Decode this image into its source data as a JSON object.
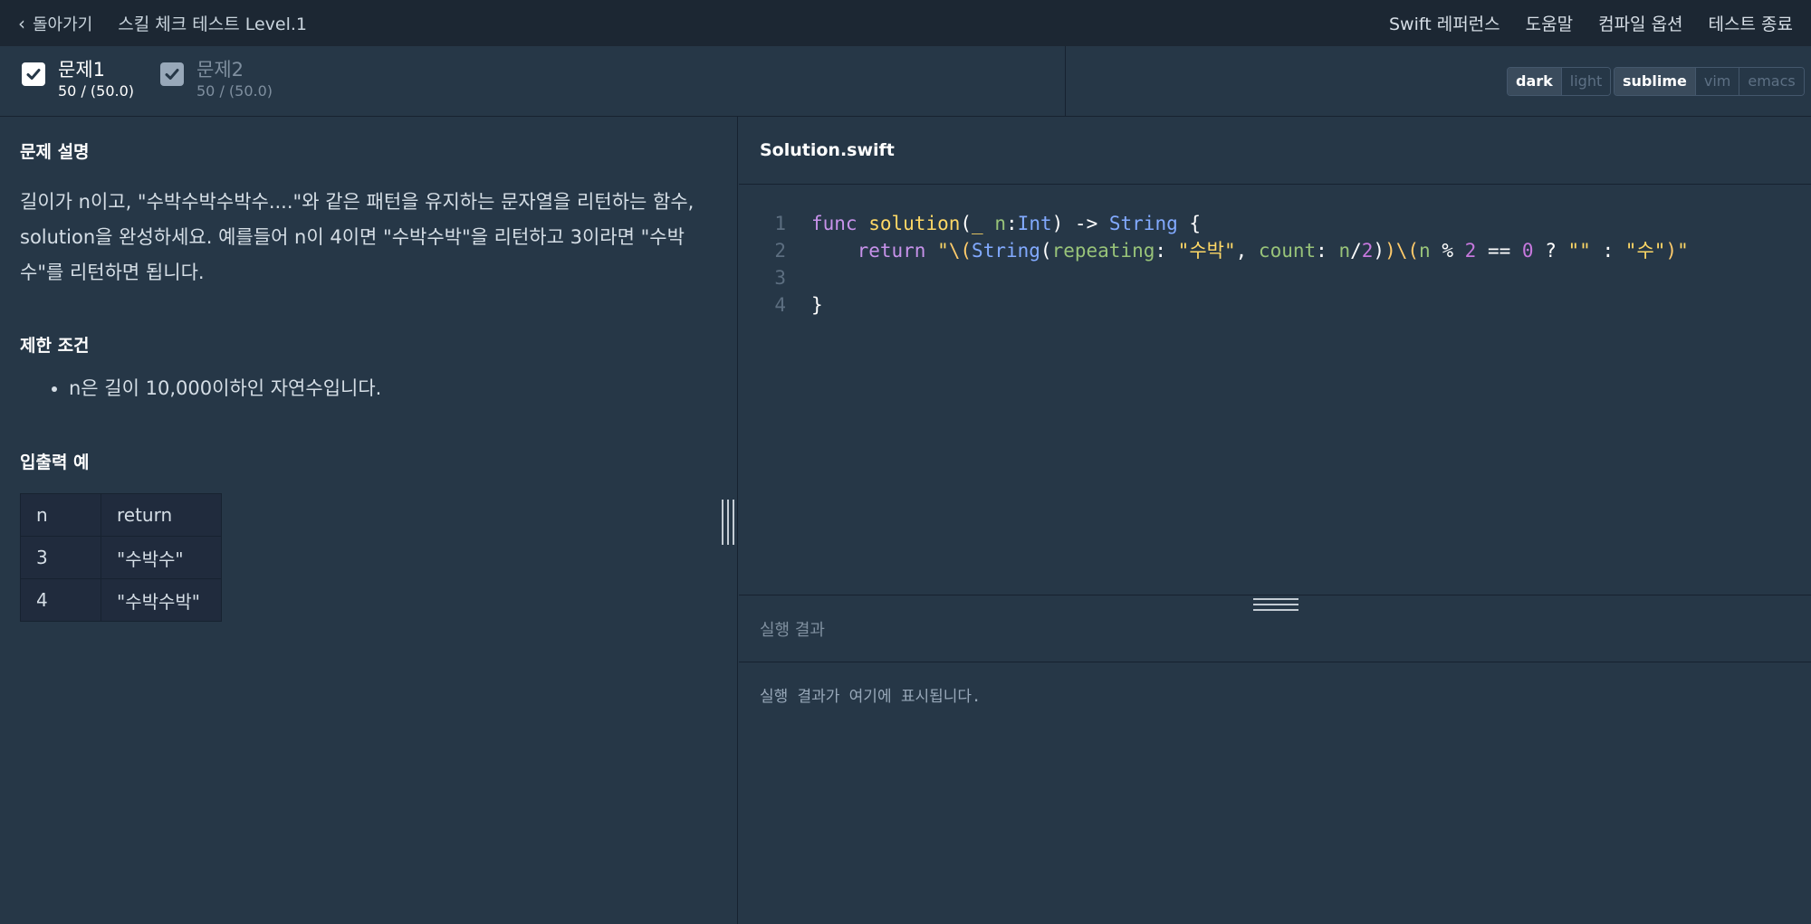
{
  "topbar": {
    "back_label": "돌아가기",
    "title": "스킬 체크 테스트 Level.1",
    "links": [
      "Swift 레퍼런스",
      "도움말",
      "컴파일 옵션",
      "테스트 종료"
    ]
  },
  "tabs": [
    {
      "title": "문제1",
      "score": "50 / (50.0)",
      "active": true
    },
    {
      "title": "문제2",
      "score": "50 / (50.0)",
      "active": false
    }
  ],
  "theme_toggle": {
    "options": [
      "dark",
      "light"
    ],
    "selected": "dark"
  },
  "keymap_toggle": {
    "options": [
      "sublime",
      "vim",
      "emacs"
    ],
    "selected": "sublime"
  },
  "problem": {
    "desc_title": "문제 설명",
    "description": "길이가 n이고, \"수박수박수박수....\"와 같은 패턴을 유지하는 문자열을 리턴하는 함수, solution을 완성하세요. 예를들어 n이 4이면 \"수박수박\"을 리턴하고 3이라면 \"수박수\"를 리턴하면 됩니다.",
    "constraints_title": "제한 조건",
    "constraints": [
      "n은 길이 10,000이하인 자연수입니다."
    ],
    "examples_title": "입출력 예",
    "examples": {
      "headers": [
        "n",
        "return"
      ],
      "rows": [
        [
          "3",
          "\"수박수\""
        ],
        [
          "4",
          "\"수박수박\""
        ]
      ]
    }
  },
  "editor": {
    "file_name": "Solution.swift",
    "line_numbers": [
      "1",
      "2",
      "3",
      "4"
    ]
  },
  "result": {
    "title": "실행 결과",
    "placeholder": "실행 결과가 여기에 표시됩니다."
  },
  "colors": {
    "background": "#263747",
    "topbar": "#1c2733",
    "accent_keyword": "#c792ea",
    "accent_string": "#ffd866"
  }
}
